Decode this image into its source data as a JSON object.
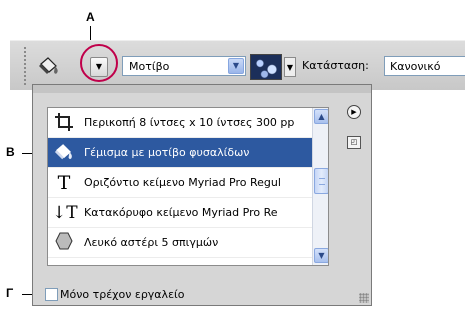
{
  "callouts": {
    "a": "A",
    "b": "B",
    "g": "Γ"
  },
  "options_bar": {
    "tool_icon": "paint-bucket-icon",
    "preset_arrow": "▼",
    "pattern_select": {
      "value": "Μοτίβο"
    },
    "pattern_swatch": "bubbles-pattern",
    "mode_label": "Κατάσταση:",
    "mode_value": "Κανονικό"
  },
  "preset_panel": {
    "items": [
      {
        "icon": "crop-icon",
        "label": "Περικοπή 8 ίντσες x 10 ίντσες 300 pp"
      },
      {
        "icon": "paint-bucket-icon",
        "label": "Γέμισμα με μοτίβο φυσαλίδων",
        "selected": true
      },
      {
        "icon": "horizontal-type-icon",
        "label": "Οριζόντιο κείμενο Myriad Pro Regul"
      },
      {
        "icon": "vertical-type-icon",
        "label": "Κατακόρυφο κείμενο Myriad Pro Re"
      },
      {
        "icon": "polygon-icon",
        "label": "Λευκό αστέρι 5 σπιγμών"
      }
    ],
    "current_tool_only": {
      "label": "Μόνο τρέχον εργαλείο",
      "checked": false
    }
  },
  "colors": {
    "selection": "#2d59a0",
    "callout_ring": "#c0004a",
    "scroll_accent": "#8aa8e0"
  }
}
